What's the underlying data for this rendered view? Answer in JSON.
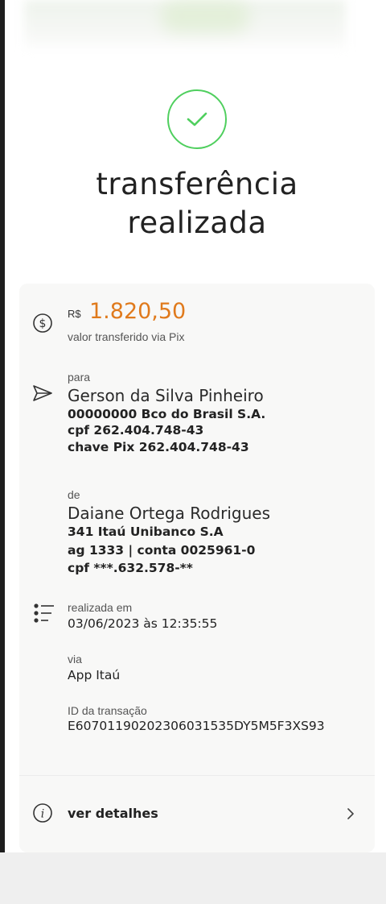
{
  "header": {
    "title_line1": "transferência",
    "title_line2": "realizada"
  },
  "amount": {
    "currency": "R$",
    "value": "1.820,50",
    "label": "valor transferido via Pix"
  },
  "recipient": {
    "label": "para",
    "name": "Gerson da Silva Pinheiro",
    "bank": "00000000 Bco do Brasil S.A.",
    "cpf": "cpf 262.404.748-43",
    "pix_key": "chave Pix 262.404.748-43"
  },
  "sender": {
    "label": "de",
    "name": "Daiane Ortega Rodrigues",
    "bank": "341 Itaú Unibanco S.A",
    "account": "ag 1333 | conta 0025961-0",
    "cpf": "cpf ***.632.578-**"
  },
  "info": {
    "date_label": "realizada em",
    "date_value": "03/06/2023 às 12:35:55",
    "via_label": "via",
    "via_value": "App Itaú",
    "id_label": "ID da transação",
    "id_value": "E60701190202306031535DY5M5F3XS93"
  },
  "actions": {
    "details_label": "ver detalhes"
  },
  "colors": {
    "success": "#4fcf5e",
    "amount": "#e07a1c"
  },
  "icons": {
    "success": "check-circle-icon",
    "amount": "dollar-circle-icon",
    "recipient": "send-icon",
    "info": "list-icon",
    "details": "info-icon",
    "chevron": "chevron-right-icon"
  }
}
